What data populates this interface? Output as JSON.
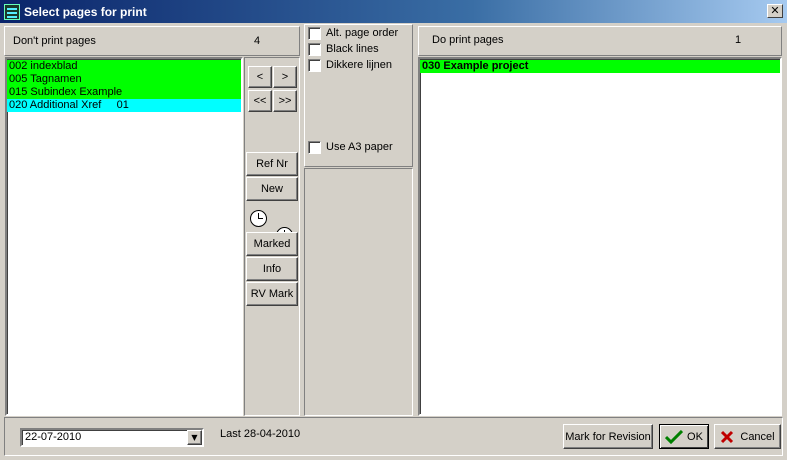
{
  "window": {
    "title": "Select pages for print",
    "close_label": "✕"
  },
  "left_panel": {
    "header_label": "Don't print pages",
    "count": "4",
    "items": [
      {
        "label": "002 indexblad",
        "color": "#00ff00"
      },
      {
        "label": "005 Tagnamen",
        "color": "#00ff00"
      },
      {
        "label": "015 Subindex Example",
        "color": "#00ff00"
      },
      {
        "label": "020 Additional Xref     01",
        "color": "#00ffff"
      }
    ]
  },
  "move_buttons": {
    "left": "<",
    "right": ">",
    "all_left": "<<",
    "all_right": ">>"
  },
  "tool_buttons": {
    "ref_nr": "Ref Nr",
    "new": "New",
    "marked": "Marked",
    "info": "Info",
    "rv_mark": "RV Mark"
  },
  "options": {
    "alt_page_order": "Alt. page order",
    "black_lines": "Black lines",
    "dikkere_lijnen": "Dikkere lijnen",
    "use_a3_paper": "Use A3 paper"
  },
  "right_panel": {
    "header_label": "Do print pages",
    "count": "1",
    "items": [
      {
        "label": "030 Example project",
        "color": "#00ff00"
      }
    ]
  },
  "footer": {
    "date_value": "22-07-2010",
    "last_label": "Last 28-04-2010",
    "mark_revision": "Mark for Revision",
    "ok": "OK",
    "cancel": "Cancel"
  }
}
